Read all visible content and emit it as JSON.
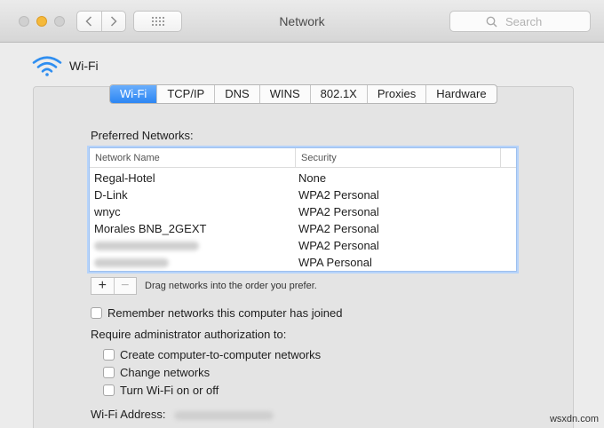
{
  "window": {
    "title": "Network",
    "search_placeholder": "Search"
  },
  "service": {
    "name": "Wi-Fi"
  },
  "tabs": [
    {
      "label": "Wi-Fi",
      "active": true
    },
    {
      "label": "TCP/IP"
    },
    {
      "label": "DNS"
    },
    {
      "label": "WINS"
    },
    {
      "label": "802.1X"
    },
    {
      "label": "Proxies"
    },
    {
      "label": "Hardware"
    }
  ],
  "preferred": {
    "label": "Preferred Networks:",
    "columns": [
      "Network Name",
      "Security"
    ],
    "rows": [
      {
        "name": "Regal-Hotel",
        "security": "None"
      },
      {
        "name": "D-Link",
        "security": "WPA2 Personal"
      },
      {
        "name": "wnyc",
        "security": "WPA2 Personal"
      },
      {
        "name": "Morales BNB_2GEXT",
        "security": "WPA2 Personal"
      },
      {
        "name": "",
        "security": "WPA2 Personal"
      },
      {
        "name": "",
        "security": "WPA Personal"
      }
    ],
    "add_label": "+",
    "remove_label": "−",
    "drag_hint": "Drag networks into the order you prefer."
  },
  "options": {
    "remember": "Remember networks this computer has joined",
    "require_admin": "Require administrator authorization to:",
    "computer_to_computer": "Create computer-to-computer networks",
    "change_networks": "Change networks",
    "turn_wifi": "Turn Wi-Fi on or off"
  },
  "address": {
    "label": "Wi-Fi Address:"
  },
  "watermark": "wsxdn.com",
  "colors": {
    "accent": "#2c86f3",
    "minimize": "#f5b93a"
  }
}
